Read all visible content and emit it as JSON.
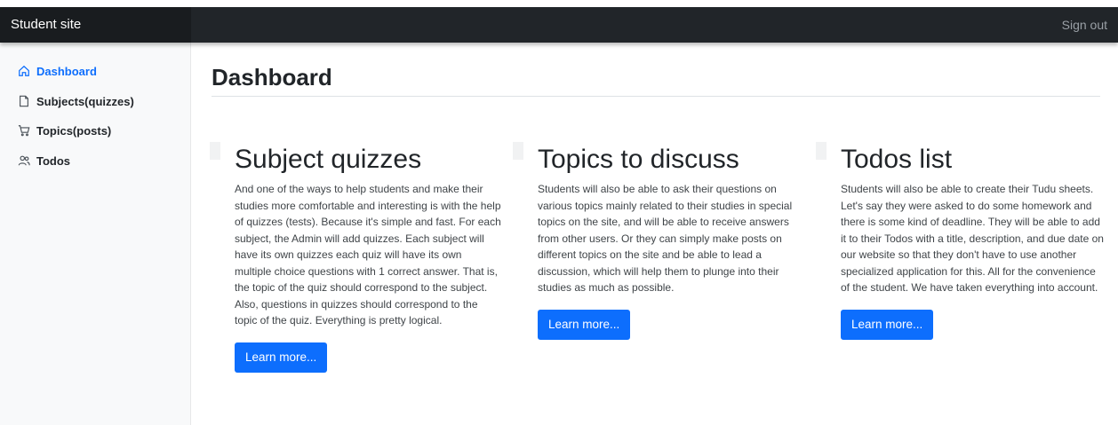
{
  "header": {
    "brand": "Student site",
    "sign_out": "Sign out"
  },
  "sidebar": {
    "items": [
      {
        "label": "Dashboard",
        "icon": "home-icon",
        "active": true
      },
      {
        "label": "Subjects(quizzes)",
        "icon": "file-icon",
        "active": false
      },
      {
        "label": "Topics(posts)",
        "icon": "cart-icon",
        "active": false
      },
      {
        "label": "Todos",
        "icon": "people-icon",
        "active": false
      }
    ]
  },
  "main": {
    "title": "Dashboard",
    "features": [
      {
        "title": "Subject quizzes",
        "text": "And one of the ways to help students and make their studies more comfortable and interesting is with the help of quizzes (tests). Because it's simple and fast. For each subject, the Admin will add quizzes. Each subject will have its own quizzes each quiz will have its own multiple choice questions with 1 correct answer. That is, the topic of the quiz should correspond to the subject. Also, questions in quizzes should correspond to the topic of the quiz. Everything is pretty logical.",
        "button": "Learn more..."
      },
      {
        "title": "Topics to discuss",
        "text": "Students will also be able to ask their questions on various topics mainly related to their studies in special topics on the site, and will be able to receive answers from other users. Or they can simply make posts on different topics on the site and be able to lead a discussion, which will help them to plunge into their studies as much as possible.",
        "button": "Learn more..."
      },
      {
        "title": "Todos list",
        "text": "Students will also be able to create their Tudu sheets. Let's say they were asked to do some homework and there is some kind of deadline. They will be able to add it to their Todos with a title, description, and due date on our website so that they don't have to use another specialized application for this. All for the convenience of the student. We have taken everything into account.",
        "button": "Learn more..."
      }
    ]
  },
  "colors": {
    "topbar": "#212529",
    "accent": "#0d6efd",
    "sidebar_bg": "#f8f9fa"
  }
}
